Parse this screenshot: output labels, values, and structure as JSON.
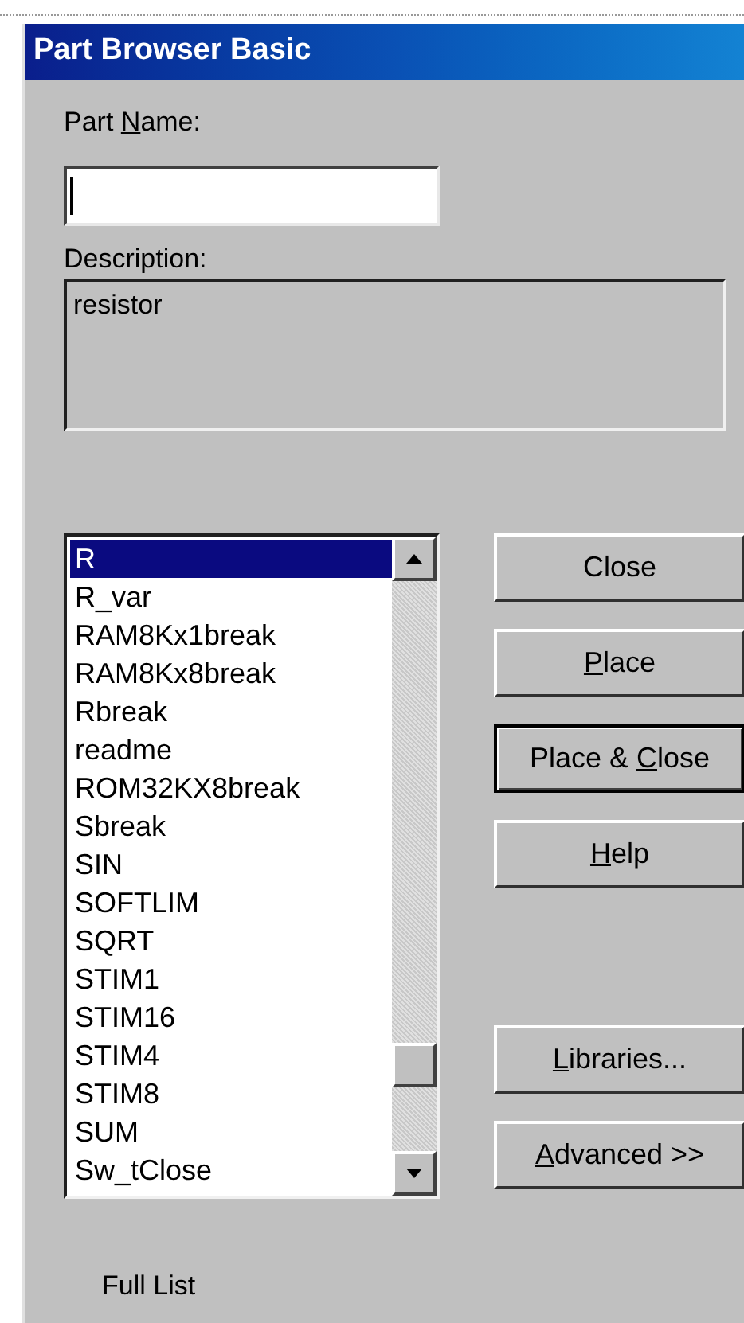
{
  "window": {
    "title": "Part Browser Basic"
  },
  "part_name": {
    "label": {
      "pre": "Part ",
      "key": "N",
      "post": "ame:"
    }
  },
  "description": {
    "label": "Description:",
    "value": "resistor"
  },
  "parts_list": {
    "items": [
      {
        "label": "R",
        "selected": true
      },
      {
        "label": "R_var",
        "selected": false
      },
      {
        "label": "RAM8Kx1break",
        "selected": false
      },
      {
        "label": "RAM8Kx8break",
        "selected": false
      },
      {
        "label": "Rbreak",
        "selected": false
      },
      {
        "label": "readme",
        "selected": false
      },
      {
        "label": "ROM32KX8break",
        "selected": false
      },
      {
        "label": "Sbreak",
        "selected": false
      },
      {
        "label": "SIN",
        "selected": false
      },
      {
        "label": "SOFTLIM",
        "selected": false
      },
      {
        "label": "SQRT",
        "selected": false
      },
      {
        "label": "STIM1",
        "selected": false
      },
      {
        "label": "STIM16",
        "selected": false
      },
      {
        "label": "STIM4",
        "selected": false
      },
      {
        "label": "STIM8",
        "selected": false
      },
      {
        "label": "SUM",
        "selected": false
      },
      {
        "label": "Sw_tClose",
        "selected": false
      }
    ]
  },
  "buttons": [
    {
      "post": "Close",
      "default": false
    },
    {
      "key": "P",
      "post": "lace",
      "default": false
    },
    {
      "pre": "Place & ",
      "key": "C",
      "post": "lose",
      "default": true
    },
    {
      "key": "H",
      "post": "elp",
      "default": false
    }
  ],
  "lower_buttons": [
    {
      "key": "L",
      "post": "ibraries...",
      "default": false
    },
    {
      "key": "A",
      "post": "dvanced >>",
      "default": false
    }
  ],
  "status": "Full List"
}
